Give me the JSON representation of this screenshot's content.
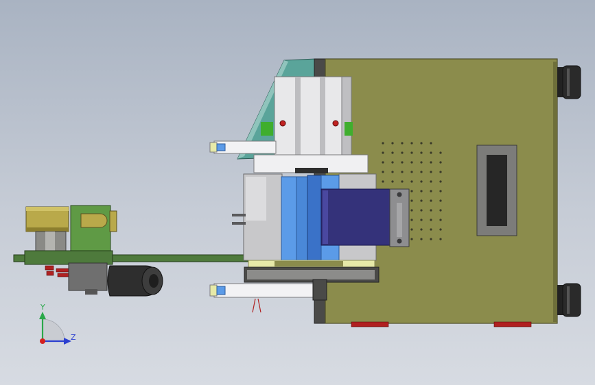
{
  "triad": {
    "y_label": "Y",
    "z_label": "Z",
    "y_color": "#2aa84a",
    "z_color": "#2b3fd0",
    "origin_color": "#d42020"
  },
  "colors": {
    "background_top": "#a9b3c2",
    "background_bottom": "#d7dbe2",
    "housing": "#8b8c4c",
    "housing_edge": "#4d4e28",
    "panel_dark": "#3a3a38",
    "plate_green": "#4e7a3c",
    "bracket_green": "#5f9a45",
    "roller_yellow": "#b9a94a",
    "motor_black": "#2a2a2a",
    "teal": "#5aa49a",
    "white_part": "#e8e8ea",
    "grey_part": "#c8c8ca",
    "blue_light": "#5b9be8",
    "blue_mid": "#3a72c8",
    "navy": "#34327a",
    "red_accent": "#b02020",
    "label_pale": "#e6e9a8"
  }
}
